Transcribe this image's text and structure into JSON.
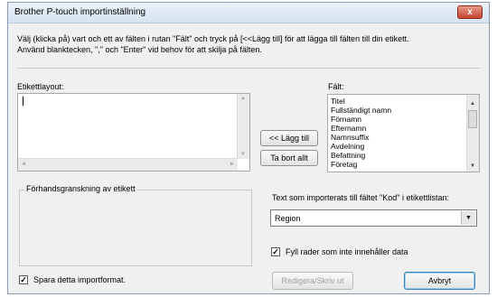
{
  "window": {
    "title": "Brother P-touch importinställning",
    "close_label": "x"
  },
  "instructions": {
    "line1": "Välj (klicka på) vart och ett av fälten i rutan \"Fält\" och tryck på [<<Lägg till] för att lägga till fälten till din etikett.",
    "line2": "Använd blanktecken, \",\" och \"Enter\" vid behov för att skilja på fälten."
  },
  "label_layout": {
    "label": "Etikettlayout:",
    "value": ""
  },
  "fields": {
    "label": "Fält:",
    "items": [
      "Titel",
      "Fullständigt namn",
      "Förnamn",
      "Efternamn",
      "Namnsuffix",
      "Avdelning",
      "Befattning",
      "Företag"
    ]
  },
  "buttons": {
    "add": "<< Lägg till",
    "remove": "Ta bort allt",
    "edit_print": "Redigera/Skriv ut",
    "cancel": "Avbryt"
  },
  "preview": {
    "label": "Förhandsgranskning av etikett"
  },
  "code_field": {
    "label": "Text som importerats till fältet \"Kod\" i etikettlistan:",
    "selected": "Region"
  },
  "checkboxes": {
    "fill_rows": {
      "label": "Fyll rader som inte innehåller data",
      "checked": true
    },
    "save_format": {
      "label": "Spara detta importformat.",
      "checked": true
    }
  },
  "icons": {
    "up_arrow": "▲",
    "down_arrow": "▼",
    "left_arrow": "◄",
    "right_arrow": "►",
    "check": "✓"
  }
}
